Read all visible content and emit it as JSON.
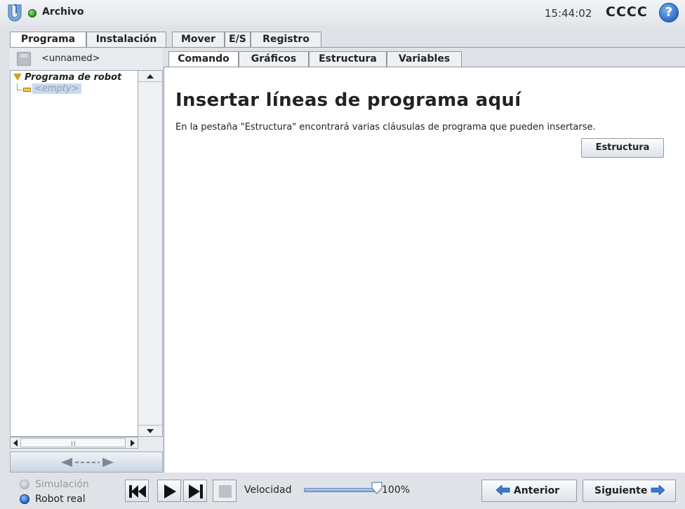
{
  "titlebar": {
    "menu": "Archivo",
    "clock": "15:44:02",
    "robot_name": "CCCC",
    "help_label": "?"
  },
  "main_tabs": [
    {
      "label": "Programa",
      "active": true
    },
    {
      "label": "Instalación",
      "active": false
    },
    {
      "label": "Mover",
      "active": false
    },
    {
      "label": "E/S",
      "active": false
    },
    {
      "label": "Registro",
      "active": false
    }
  ],
  "left_panel": {
    "file_name": "<unnamed>",
    "tree": {
      "root": "Programa de robot",
      "child": "<empty>"
    }
  },
  "sub_tabs": [
    {
      "label": "Comando",
      "active": true
    },
    {
      "label": "Gráficos",
      "active": false
    },
    {
      "label": "Estructura",
      "active": false
    },
    {
      "label": "Variables",
      "active": false
    }
  ],
  "content": {
    "title": "Insertar líneas de programa aquí",
    "description": "En la pestaña \"Estructura\" encontrará varias cláusulas de programa que pueden insertarse.",
    "button_label": "Estructura"
  },
  "footer": {
    "mode_simulation": "Simulación",
    "mode_real": "Robot real",
    "speed_label": "Velocidad",
    "speed_value": "100%",
    "speed_fraction": 1.0,
    "prev_label": "Anterior",
    "next_label": "Siguiente"
  },
  "colors": {
    "accent_blue": "#2d6cc8",
    "status_green": "#2f8a1a",
    "tree_selection": "#c8daf3"
  }
}
